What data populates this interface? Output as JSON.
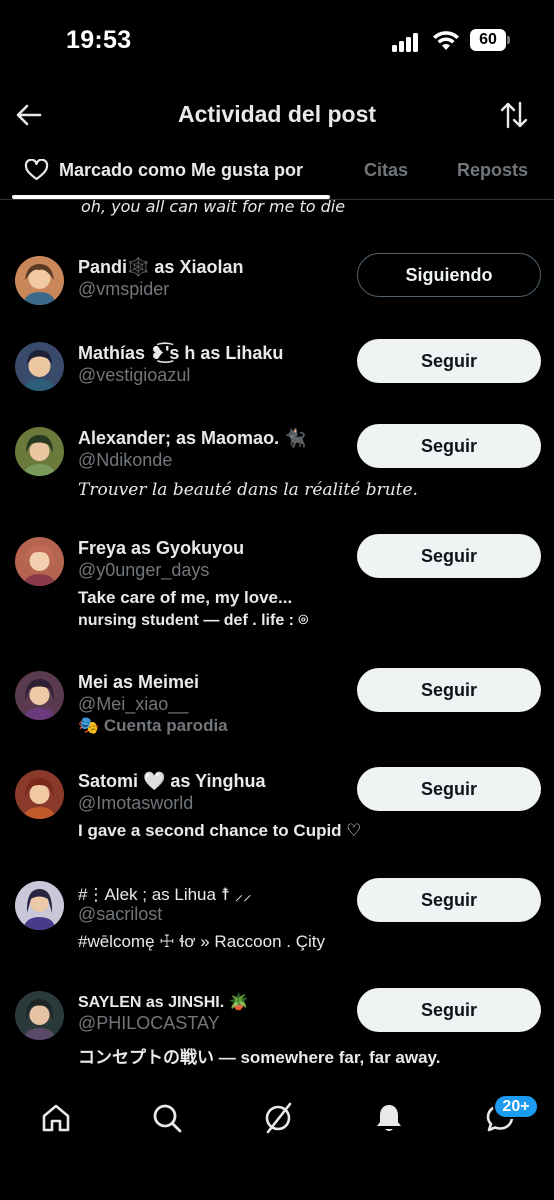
{
  "status_bar": {
    "time": "19:53",
    "battery": "60"
  },
  "header": {
    "title": "Actividad del post"
  },
  "tabs": [
    {
      "label": "Marcado como Me gusta por",
      "active": true
    },
    {
      "label": "Citas",
      "active": false
    },
    {
      "label": "Reposts",
      "active": false
    }
  ],
  "cut_bio": "oh, you all can wait for me to die",
  "users": [
    {
      "name": "Pandi🕸️ as Xiaolan",
      "handle": "@vmspider",
      "bio": "",
      "bio2": "",
      "button": "Siguiendo",
      "following": true,
      "avatar_bg": "#c9875a"
    },
    {
      "name": "Mathías ❥͜͡'s h as Lihaku",
      "handle": "@vestigioazul",
      "bio": "",
      "bio2": "",
      "button": "Seguir",
      "following": false,
      "avatar_bg": "#3a4a6b"
    },
    {
      "name": "Alexander; as Maomao. 🐈‍⬛",
      "handle": "@Ndikonde",
      "bio": "Trouver la beauté dans la réalité brute.",
      "bio2": "",
      "button": "Seguir",
      "following": false,
      "avatar_bg": "#6b7a3a"
    },
    {
      "name": "Freya as Gyokuyou",
      "handle": "@y0unger_days",
      "bio": "Take care of me, my love...",
      "bio2": "nursing student — def . life : ⌾",
      "button": "Seguir",
      "following": false,
      "avatar_bg": "#b5654f"
    },
    {
      "name": "Mei as Meimei",
      "handle": "@Mei_xiao__",
      "bio": "🎭 Cuenta parodia",
      "bio2": "",
      "button": "Seguir",
      "following": false,
      "avatar_bg": "#5a3a4e"
    },
    {
      "name": "Satomi 🤍 as Yinghua",
      "handle": "@Imotasworld",
      "bio": "I gave a second chance to Cupid ♡",
      "bio2": "",
      "button": "Seguir",
      "following": false,
      "avatar_bg": "#8a3a2a"
    },
    {
      "name": "#⋮Alek ; as Lihua ☨ ⸝⸝",
      "handle": "@sacrilost",
      "bio": "#wēlcomę ☩ ɬơ » Raccoon . Çity",
      "bio2": "",
      "button": "Seguir",
      "following": false,
      "avatar_bg": "#3a3f6b"
    },
    {
      "name": "SAYLEN as JINSHI. 🪴",
      "handle": "@PHILOCASTAY",
      "bio": "コンセプトの戦い — somewhere far, far away.",
      "bio2": "",
      "button": "Seguir",
      "following": false,
      "avatar_bg": "#2a3a3a"
    }
  ],
  "bottom_nav": {
    "badge": "20+"
  },
  "colors": {
    "background": "#000000",
    "text": "#e7e9ea",
    "muted": "#71767b",
    "accent": "#1d9bf0"
  },
  "icons": [
    "back-arrow-icon",
    "sort-icon",
    "heart-icon",
    "home-icon",
    "search-icon",
    "grok-icon",
    "bell-icon",
    "messages-icon"
  ]
}
